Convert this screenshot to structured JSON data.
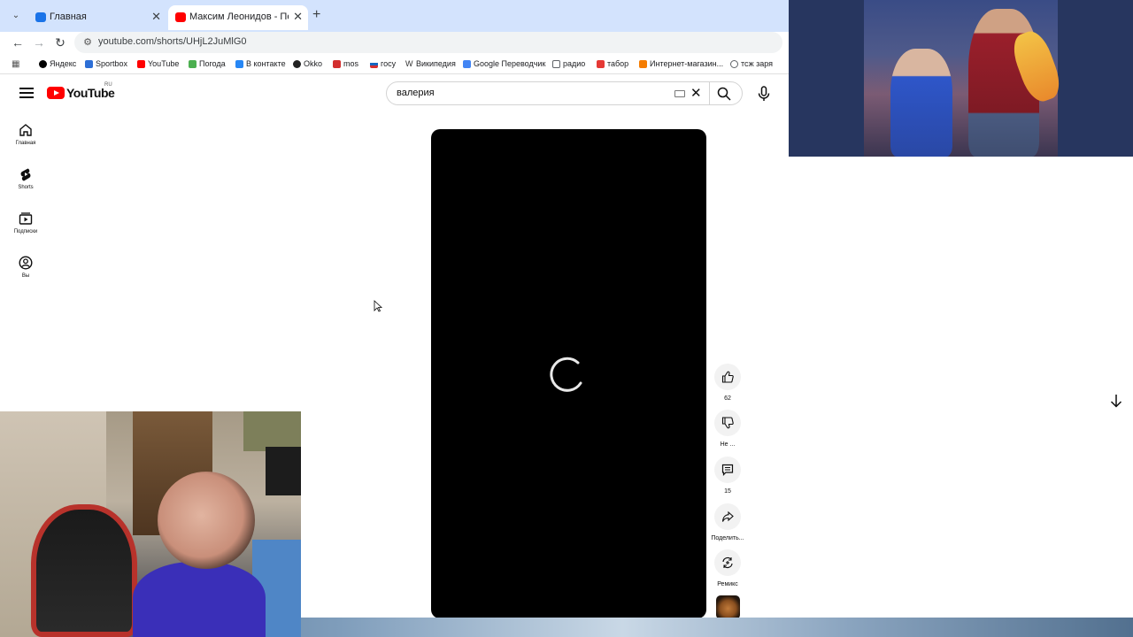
{
  "browser": {
    "tabs": [
      {
        "title": "Главная",
        "active": false
      },
      {
        "title": "Максим Леонидов - Песенка о...",
        "active": true
      }
    ],
    "url": "youtube.com/shorts/UHjL2JuMlG0",
    "bookmarks": [
      {
        "label": "Яндекс",
        "color": "#000000"
      },
      {
        "label": "Sportbox",
        "color": "#2d6fd6"
      },
      {
        "label": "YouTube",
        "color": "#ff0000"
      },
      {
        "label": "Погода",
        "color": "#4caf50"
      },
      {
        "label": "В контакте",
        "color": "#2787f5"
      },
      {
        "label": "Okko",
        "color": "#222222"
      },
      {
        "label": "mos",
        "color": "#d32f2f"
      },
      {
        "label": "госу",
        "color": "#1565c0"
      },
      {
        "label": "Википедия",
        "color": "#555555"
      },
      {
        "label": "Google Переводчик",
        "color": "#4285f4"
      },
      {
        "label": "радио",
        "color": "#5f6368"
      },
      {
        "label": "табор",
        "color": "#e53935"
      },
      {
        "label": "Интернет-магазин...",
        "color": "#f57c00"
      },
      {
        "label": "тсж заря",
        "color": "#5f6368"
      }
    ]
  },
  "youtube": {
    "logo_text": "YouTube",
    "region": "RU",
    "search_value": "валерия",
    "sidebar": [
      {
        "label": "Главная",
        "icon": "home-icon"
      },
      {
        "label": "Shorts",
        "icon": "shorts-icon"
      },
      {
        "label": "Подписки",
        "icon": "subscriptions-icon"
      },
      {
        "label": "Вы",
        "icon": "account-icon"
      }
    ],
    "actions": {
      "like_count": "62",
      "dislike_label": "Не ...",
      "comments_count": "15",
      "share_label": "Поделить...",
      "remix_label": "Ремикс"
    }
  },
  "colors": {
    "youtube_red": "#ff0000",
    "tabstrip": "#d3e3fd",
    "player_bg": "#000000"
  }
}
